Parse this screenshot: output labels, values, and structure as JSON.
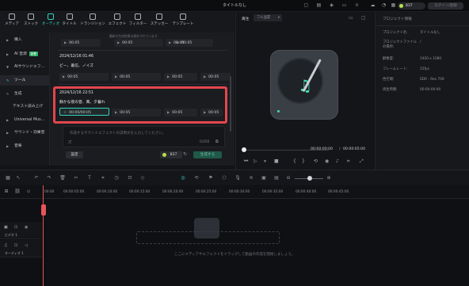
{
  "window": {
    "title": "タイトルなし",
    "credits": "837",
    "login_button": "ログイン/登録"
  },
  "top_tabs": [
    "メディア",
    "ストック",
    "オーディオ",
    "タイトル",
    "トランジション",
    "エフェクト",
    "フィルター",
    "ステッカー",
    "テンプレート"
  ],
  "sidebar": {
    "items": [
      {
        "label": "購入"
      },
      {
        "label": "AI 音源",
        "badge": "新着"
      },
      {
        "label": "AIサウンドエフ…"
      },
      {
        "label": "ツール"
      },
      {
        "label": "生成"
      },
      {
        "label": "テキスト読み上げ"
      },
      {
        "label": "Universal Mus…"
      },
      {
        "label": "サウンド・効果音"
      },
      {
        "label": "音楽"
      }
    ]
  },
  "content": {
    "note_line": "最新の生成結果は保存されています",
    "entries": [
      {
        "date": "",
        "subject": "",
        "cells": [
          "00:05",
          "00:05",
          "00:05",
          "00:05"
        ]
      },
      {
        "date": "2024/12/16 01:46",
        "subject": "ビー、着信、ノイズ",
        "cells": [
          "00:05",
          "00:05",
          "00:05",
          "00:05"
        ]
      },
      {
        "date": "2024/12/16 22:51",
        "subject": "静かな夜の音、風、夕暮れ",
        "cells": [
          "00:00/00:05",
          "00:05",
          "00:05",
          "00:05"
        ]
      }
    ],
    "prompt_placeholder": "作成するサウンドエフェクトの説明文を入力してください。",
    "char_count": "0/200",
    "settings_button": "設定",
    "credit_cost": "837",
    "generate_button": "生成する"
  },
  "preview": {
    "player_label": "再生",
    "quality_label": "フル品質",
    "time_current": "00:00:00:00",
    "time_total": "00:00:05:00"
  },
  "properties": {
    "header": "プロジェクト情報",
    "rows": [
      {
        "label": "プロジェクト名:",
        "value": "タイトルなし"
      },
      {
        "label": "プロジェクトファイルの場所:",
        "value": "/"
      },
      {
        "label": "解像度:",
        "value": "1920 x 1080"
      },
      {
        "label": "フレームレート:",
        "value": "25fps"
      },
      {
        "label": "色空間:",
        "value": "SDR - Rec.709"
      },
      {
        "label": "再生時間:",
        "value": "00:00:00:00"
      }
    ]
  },
  "timeline": {
    "ticks": [
      "00:00",
      "00:00:05:00",
      "00:00:10:00",
      "00:00:15:00",
      "00:00:20:00",
      "00:00:25:00",
      "00:00:30:00",
      "00:00:35:00",
      "00:00:40:00",
      "00:00:45:00"
    ],
    "video_track": "ビデオ 1",
    "audio_track": "オーディオ 1",
    "drop_hint": "ここにメディアやエフェクトをドラッグして動画の作成を開始しましょう。"
  }
}
